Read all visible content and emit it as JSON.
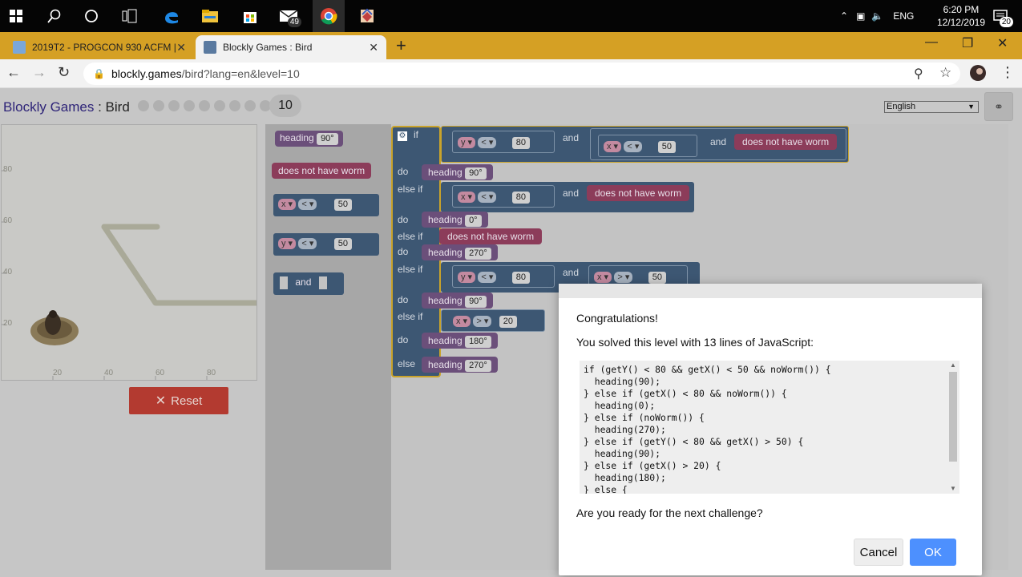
{
  "taskbar": {
    "mail_badge": "49",
    "lang": "ENG",
    "time": "6:20 PM",
    "date": "12/12/2019",
    "notif_badge": "20"
  },
  "tabs": [
    {
      "title": "2019T2 - PROGCON 930 ACFM |",
      "active": false
    },
    {
      "title": "Blockly Games : Bird",
      "active": true
    }
  ],
  "address": {
    "host": "blockly.games",
    "path": "/bird?lang=en&level=10"
  },
  "page": {
    "title": "Blockly Games",
    "separator": " : ",
    "subtitle": "Bird",
    "level": "10",
    "language": "English",
    "reset_label": "Reset",
    "axis_labels_y": [
      "80",
      "60",
      "40",
      "20"
    ],
    "axis_labels_x": [
      "20",
      "40",
      "60",
      "80"
    ]
  },
  "flyout": {
    "heading_label": "heading",
    "heading_value": "90°",
    "no_worm": "does not have worm",
    "x_var": "x",
    "y_var": "y",
    "lt": "<",
    "cmp_value": "50",
    "and_label": "and"
  },
  "workspace": {
    "kw_if": "if",
    "kw_do": "do",
    "kw_else_if": "else if",
    "kw_else": "else",
    "kw_and": "and",
    "heading": "heading",
    "no_worm": "does not have worm",
    "cond1": {
      "a_var": "y",
      "a_op": "<",
      "a_val": "80",
      "b_var": "x",
      "b_op": "<",
      "b_val": "50"
    },
    "do1": "90°",
    "cond2": {
      "var": "x",
      "op": "<",
      "val": "80"
    },
    "do2": "0°",
    "do3": "270°",
    "cond4": {
      "a_var": "y",
      "a_op": "<",
      "a_val": "80",
      "b_var": "x",
      "b_op": ">",
      "b_val": "50"
    },
    "do4": "90°",
    "cond5": {
      "var": "x",
      "op": ">",
      "val": "20"
    },
    "do5": "180°",
    "else_do": "270°"
  },
  "dialog": {
    "title": "Congratulations!",
    "solved": "You solved this level with 13 lines of JavaScript:",
    "code": [
      "if (getY() < 80 && getX() < 50 && noWorm()) {",
      "  heading(90);",
      "} else if (getX() < 80 && noWorm()) {",
      "  heading(0);",
      "} else if (noWorm()) {",
      "  heading(270);",
      "} else if (getY() < 80 && getX() > 50) {",
      "  heading(90);",
      "} else if (getX() > 20) {",
      "  heading(180);",
      "} else {"
    ],
    "question": "Are you ready for the next challenge?",
    "cancel": "Cancel",
    "ok": "OK"
  }
}
